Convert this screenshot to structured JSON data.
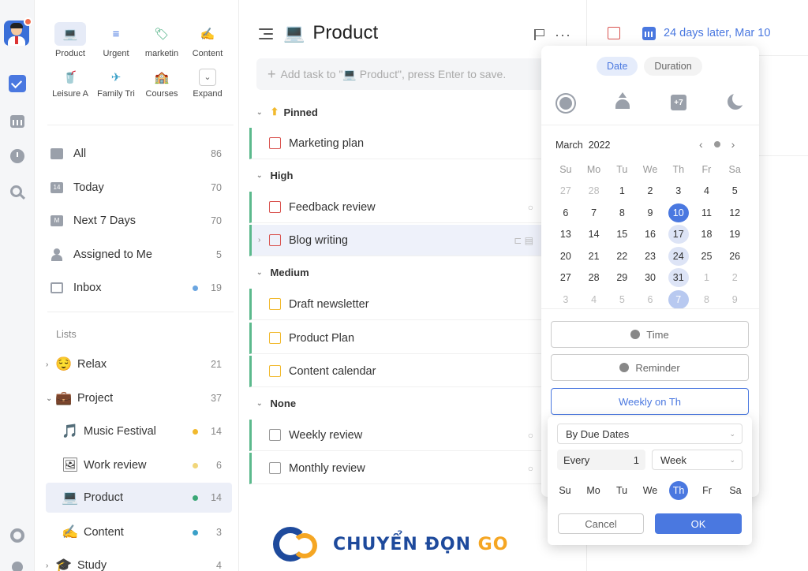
{
  "sidebar": {
    "projects_grid": [
      {
        "label": "Product",
        "icon": "💻",
        "active": true
      },
      {
        "label": "Urgent",
        "icon": "≡"
      },
      {
        "label": "marketin",
        "icon": "🏷"
      },
      {
        "label": "Content",
        "icon": "✍"
      },
      {
        "label": "Leisure A",
        "icon": "🥤"
      },
      {
        "label": "Family Tri",
        "icon": "✈"
      },
      {
        "label": "Courses",
        "icon": "🏫"
      },
      {
        "label": "Expand",
        "icon": "⌄"
      }
    ],
    "smart_lists": [
      {
        "label": "All",
        "count": "86"
      },
      {
        "label": "Today",
        "count": "70"
      },
      {
        "label": "Next 7 Days",
        "count": "70"
      },
      {
        "label": "Assigned to Me",
        "count": "5"
      },
      {
        "label": "Inbox",
        "count": "19",
        "dot": "#6aa5e0"
      }
    ],
    "lists_header": "Lists",
    "lists": [
      {
        "label": "Relax",
        "emoji": "😌",
        "count": "21",
        "chevron": "›"
      },
      {
        "label": "Project",
        "emoji": "💼",
        "count": "37",
        "chevron": "⌄"
      },
      {
        "label": "Music Festival",
        "emoji": "🎵",
        "count": "14",
        "dot": "#f1b92d"
      },
      {
        "label": "Work review",
        "emoji": "🖼",
        "count": "6",
        "dot": "#f1d67a"
      },
      {
        "label": "Product",
        "emoji": "💻",
        "count": "14",
        "dot": "#3aa776",
        "active": true
      },
      {
        "label": "Content",
        "emoji": "✍",
        "count": "3",
        "dot": "#3aa0c8"
      },
      {
        "label": "Study",
        "emoji": "🎓",
        "count": "4",
        "chevron": "›"
      }
    ]
  },
  "main": {
    "title": "Product",
    "title_icon": "💻",
    "add_task_placeholder": "Add task to \"💻 Product\", press Enter to save.",
    "sections": [
      {
        "name": "Pinned",
        "tasks": [
          {
            "title": "Marketing plan",
            "color": "red"
          }
        ]
      },
      {
        "name": "High",
        "tasks": [
          {
            "title": "Feedback review",
            "color": "red"
          },
          {
            "title": "Blog writing",
            "color": "red"
          }
        ]
      },
      {
        "name": "Medium",
        "tasks": [
          {
            "title": "Draft newsletter",
            "color": "yellow"
          },
          {
            "title": "Product Plan",
            "color": "yellow"
          },
          {
            "title": "Content calendar",
            "color": "yellow"
          }
        ]
      },
      {
        "name": "None",
        "tasks": [
          {
            "title": "Weekly review",
            "color": "grey"
          },
          {
            "title": "Monthly review",
            "color": "grey"
          }
        ]
      }
    ]
  },
  "detail": {
    "due_text": "24 days later, Mar 10"
  },
  "popup": {
    "tab_date": "Date",
    "tab_duration": "Duration",
    "quick_next_week_label": "+7",
    "month_label": "March",
    "year_label": "2022",
    "weekdays": [
      "Su",
      "Mo",
      "Tu",
      "We",
      "Th",
      "Fr",
      "Sa"
    ],
    "weeks": [
      [
        "27",
        "28",
        "1",
        "2",
        "3",
        "4",
        "5"
      ],
      [
        "6",
        "7",
        "8",
        "9",
        "10",
        "11",
        "12"
      ],
      [
        "13",
        "14",
        "15",
        "16",
        "17",
        "18",
        "19"
      ],
      [
        "20",
        "21",
        "22",
        "23",
        "24",
        "25",
        "26"
      ],
      [
        "27",
        "28",
        "29",
        "30",
        "31",
        "1",
        "2"
      ],
      [
        "3",
        "4",
        "5",
        "6",
        "7",
        "8",
        "9"
      ]
    ],
    "selected_day": "10",
    "time_label": "Time",
    "reminder_label": "Reminder",
    "repeat_label": "Weekly on Th"
  },
  "repeat_panel": {
    "mode": "By Due Dates",
    "every_label": "Every",
    "every_value": "1",
    "unit": "Week",
    "days": [
      "Su",
      "Mo",
      "Tu",
      "We",
      "Th",
      "Fr",
      "Sa"
    ],
    "selected": "Th",
    "cancel_label": "Cancel",
    "ok_label": "OK"
  },
  "watermark": {
    "text_main": "CHUYỂN ĐỌN ",
    "text_accent": "GO"
  }
}
